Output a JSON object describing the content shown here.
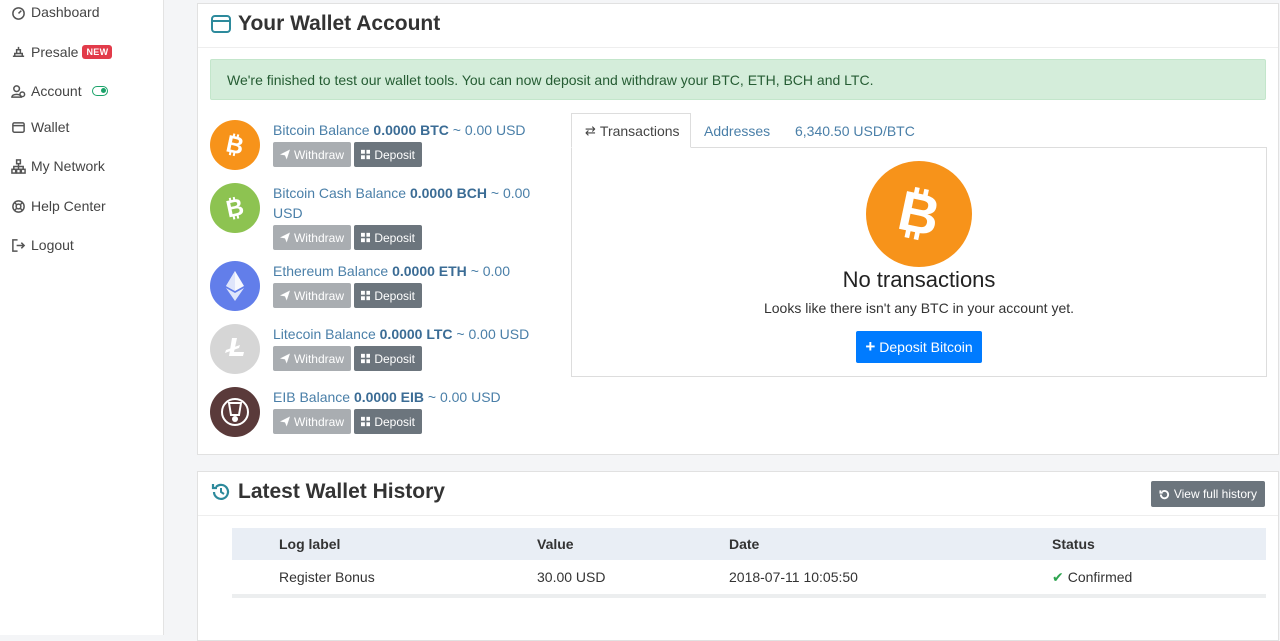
{
  "sidebar": {
    "items": [
      {
        "label": "Dashboard",
        "icon": "dashboard-icon"
      },
      {
        "label": "Presale",
        "icon": "presale-icon",
        "badge": "NEW"
      },
      {
        "label": "Account",
        "icon": "account-icon",
        "toggle": true
      },
      {
        "label": "Wallet",
        "icon": "wallet-icon"
      },
      {
        "label": "My Network",
        "icon": "network-icon"
      },
      {
        "label": "Help Center",
        "icon": "help-icon"
      },
      {
        "label": "Logout",
        "icon": "logout-icon"
      }
    ]
  },
  "wallet": {
    "title": "Your Wallet Account",
    "alert": "We're finished to test our wallet tools. You can now deposit and withdraw your BTC, ETH, BCH and LTC.",
    "withdraw_label": "Withdraw",
    "deposit_label": "Deposit",
    "coins": [
      {
        "prefix": "Bitcoin Balance",
        "amount": "0.0000 BTC",
        "usd": "~ 0.00 USD",
        "color": "#f7931a"
      },
      {
        "prefix": "Bitcoin Cash Balance",
        "amount": "0.0000 BCH",
        "usd": "~ 0.00 USD",
        "color": "#8dc351"
      },
      {
        "prefix": "Ethereum Balance",
        "amount": "0.0000 ETH",
        "usd": "~ 0.00 USD",
        "color": "#627eea"
      },
      {
        "prefix": "Litecoin Balance",
        "amount": "0.0000 LTC",
        "usd": "~ 0.00 USD",
        "color": "#d6d6d6"
      },
      {
        "prefix": "EIB Balance",
        "amount": "0.0000 EIB",
        "usd": "~ 0.00 USD",
        "color": "#5a3a3a"
      }
    ],
    "tabs": [
      {
        "label": "Transactions"
      },
      {
        "label": "Addresses"
      },
      {
        "label": "6,340.50 USD/BTC"
      }
    ],
    "empty": {
      "heading": "No transactions",
      "message": "Looks like there isn't any BTC in your account yet.",
      "button": "Deposit Bitcoin"
    }
  },
  "history": {
    "title": "Latest Wallet History",
    "view_full": "View full history",
    "columns": [
      "Log label",
      "Value",
      "Date",
      "Status"
    ],
    "rows": [
      {
        "label": "Register Bonus",
        "value": "30.00 USD",
        "date": "2018-07-11 10:05:50",
        "status": "Confirmed"
      }
    ]
  },
  "colors": {
    "accent": "#007bff",
    "alert_bg": "#d4edda",
    "confirmed": "#2ea44f",
    "badge": "#e23b4a"
  }
}
